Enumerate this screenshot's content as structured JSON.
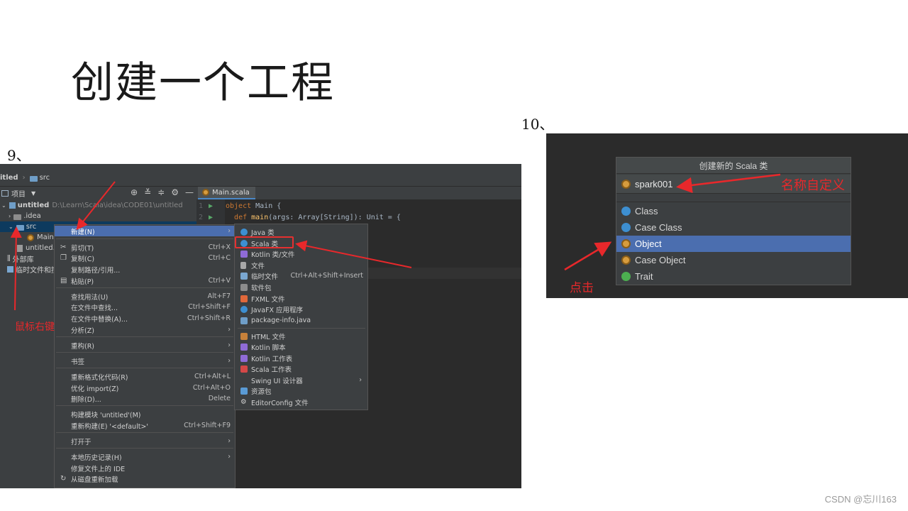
{
  "slide": {
    "title": "创建一个工程",
    "step9": "9、",
    "step10": "10、",
    "watermark": "CSDN @忘川163"
  },
  "ide": {
    "breadcrumb": [
      "itled",
      "src"
    ],
    "project_label": "项目",
    "editor_tab": "Main.scala",
    "tree": {
      "root_name": "untitled",
      "root_path": "D:\\Learn\\Scala\\idea\\CODE01\\untitled",
      "idea": ".idea",
      "src": "src",
      "main": "Main",
      "iml": "untitled.",
      "external": "外部库",
      "scratch": "临时文件和控"
    },
    "code": {
      "line1_no": "1",
      "line2_no": "2",
      "line1_kw": "object",
      "line1_rest": " Main {",
      "line2_kw": "def",
      "line2_fn": "main",
      "line2_rest": "(args: Array[String]): Unit = {"
    },
    "context_menu": [
      {
        "label": "新建(N)",
        "shortcut": "",
        "submenu": true
      },
      {
        "label": "剪切(T)",
        "shortcut": "Ctrl+X"
      },
      {
        "label": "复制(C)",
        "shortcut": "Ctrl+C"
      },
      {
        "label": "复制路径/引用...",
        "shortcut": ""
      },
      {
        "label": "粘贴(P)",
        "shortcut": "Ctrl+V"
      },
      {
        "label": "查找用法(U)",
        "shortcut": "Alt+F7"
      },
      {
        "label": "在文件中查找...",
        "shortcut": "Ctrl+Shift+F"
      },
      {
        "label": "在文件中替换(A)...",
        "shortcut": "Ctrl+Shift+R"
      },
      {
        "label": "分析(Z)",
        "shortcut": "",
        "submenu": true
      },
      {
        "label": "重构(R)",
        "shortcut": "",
        "submenu": true
      },
      {
        "label": "书签",
        "shortcut": "",
        "submenu": true
      },
      {
        "label": "重新格式化代码(R)",
        "shortcut": "Ctrl+Alt+L"
      },
      {
        "label": "优化 import(Z)",
        "shortcut": "Ctrl+Alt+O"
      },
      {
        "label": "删除(D)...",
        "shortcut": "Delete"
      },
      {
        "label": "构建模块 'untitled'(M)",
        "shortcut": ""
      },
      {
        "label": "重新构建(E) '<default>'",
        "shortcut": "Ctrl+Shift+F9"
      },
      {
        "label": "打开于",
        "shortcut": "",
        "submenu": true
      },
      {
        "label": "本地历史记录(H)",
        "shortcut": "",
        "submenu": true
      },
      {
        "label": "修复文件上的 IDE",
        "shortcut": ""
      },
      {
        "label": "从磁盘重新加载",
        "shortcut": ""
      }
    ],
    "new_submenu": [
      {
        "label": "Java 类",
        "shortcut": ""
      },
      {
        "label": "Scala 类",
        "shortcut": ""
      },
      {
        "label": "Kotlin 类/文件",
        "shortcut": ""
      },
      {
        "label": "文件",
        "shortcut": ""
      },
      {
        "label": "临时文件",
        "shortcut": "Ctrl+Alt+Shift+Insert"
      },
      {
        "label": "软件包",
        "shortcut": ""
      },
      {
        "label": "FXML 文件",
        "shortcut": ""
      },
      {
        "label": "JavaFX 应用程序",
        "shortcut": ""
      },
      {
        "label": "package-info.java",
        "shortcut": ""
      },
      {
        "label": "HTML 文件",
        "shortcut": ""
      },
      {
        "label": "Kotlin 脚本",
        "shortcut": ""
      },
      {
        "label": "Kotlin 工作表",
        "shortcut": ""
      },
      {
        "label": "Scala 工作表",
        "shortcut": ""
      },
      {
        "label": "Swing UI 设计器",
        "shortcut": "",
        "submenu": true
      },
      {
        "label": "资源包",
        "shortcut": ""
      },
      {
        "label": "EditorConfig 文件",
        "shortcut": ""
      }
    ],
    "annotation": "鼠标右键"
  },
  "dialog": {
    "title": "创建新的 Scala 类",
    "name_value": "spark001",
    "kinds": [
      "Class",
      "Case Class",
      "Object",
      "Case Object",
      "Trait"
    ],
    "selected_kind": "Object",
    "annotation_name": "名称自定义",
    "annotation_click": "点击"
  },
  "colors": {
    "annotation_red": "#e8282b",
    "selection_blue": "#4b6eaf",
    "ide_bg": "#2b2b2b",
    "panel_bg": "#3c3f41",
    "scala_object_orange": "#d79c3e",
    "trait_green": "#4caf50"
  }
}
